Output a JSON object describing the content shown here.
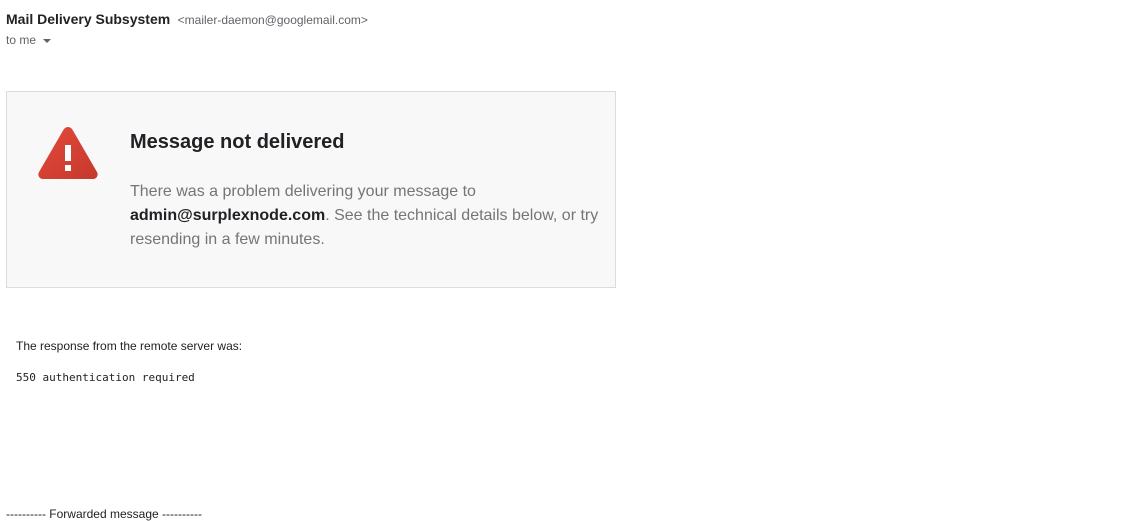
{
  "header": {
    "sender_name": "Mail Delivery Subsystem",
    "sender_email": "<mailer-daemon@googlemail.com>",
    "recipient": "to me",
    "recipient_dropdown_icon": "chevron-down-icon"
  },
  "notice": {
    "icon": "warning-icon",
    "icon_color": "#db4437",
    "title": "Message not delivered",
    "body_prefix": "There was a problem delivering your message to ",
    "address": "admin@surplexnode.com",
    "body_suffix": ". See the technical details below, or try resending in a few minutes."
  },
  "response": {
    "label": "The response from the remote server was:",
    "code": "550 authentication required"
  },
  "forwarded": {
    "label": "---------- Forwarded message ----------"
  }
}
